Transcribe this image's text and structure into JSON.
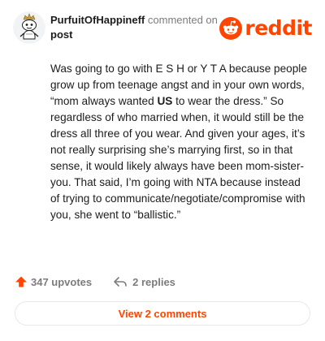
{
  "comment": {
    "username": "PurfuitOfHappineff",
    "commented_on": "commented on",
    "post_link": "post",
    "body_1": "Was going to go with E S H or Y T A because people grow up from teenage angst and in your own words, “mom always wanted ",
    "body_bold": "US",
    "body_2": " to wear the dress.” So regardless of who married when, it would still be the dress all three of you wear. And given your ages, it’s not really surprising she’s marrying first, so in that sense, it would likely always have been mom-sister-you. That said, I’m going with NTA because instead of trying to communicate/negotiate/compromise with you, she went to “ballistic.”"
  },
  "logo": {
    "wordmark": "reddit",
    "icon": "reddit-snoo-icon"
  },
  "actions": {
    "upvotes": "347 upvotes",
    "replies": "2 replies",
    "upvote_icon": "upvote-arrow-icon",
    "reply_icon": "reply-arrow-icon"
  },
  "view_replies_button": "View 2 comments",
  "colors": {
    "brand": "#ff4500",
    "text": "#1c1c1c",
    "muted": "#7c7c7c",
    "border": "#e6e8ea"
  }
}
